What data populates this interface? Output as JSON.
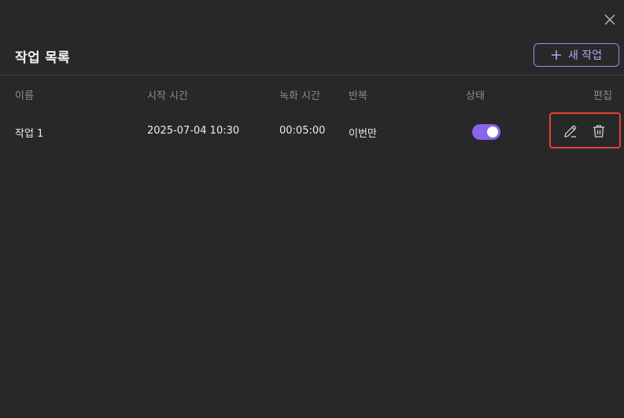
{
  "dialog": {
    "title": "작업 목록",
    "new_button_label": "새 작업",
    "close_icon": "close-icon"
  },
  "table": {
    "headers": {
      "name": "이름",
      "start_time": "시작 시간",
      "record_time": "녹화 시간",
      "repeat": "반복",
      "status": "상태",
      "edit": "편집"
    },
    "rows": [
      {
        "name": "작업 1",
        "start_time": "2025-07-04 10:30",
        "record_time": "00:05:00",
        "repeat": "이번만",
        "status_enabled": true
      }
    ]
  },
  "colors": {
    "accent": "#8a63f0",
    "highlight": "#e8412f",
    "background": "#282828"
  }
}
